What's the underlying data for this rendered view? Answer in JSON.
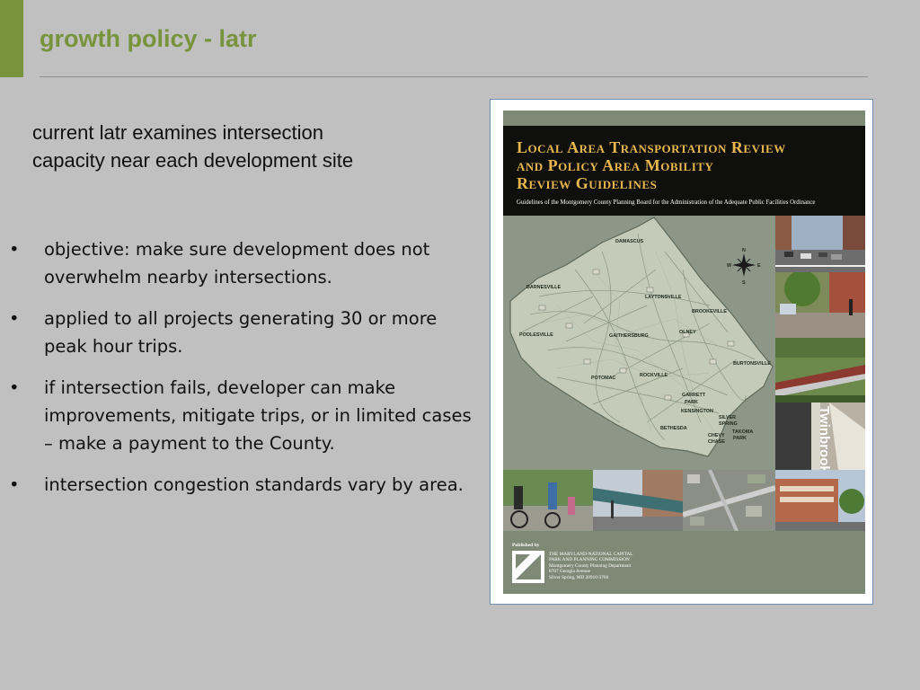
{
  "slide": {
    "title": "growth policy - latr",
    "intro": "current latr examines intersection capacity near each development site",
    "bullet_symbol": "•",
    "bullets": [
      "objective: make sure development does not overwhelm nearby intersections.",
      "applied to all projects generating 30 or more peak hour trips.",
      "if intersection fails, developer can make improvements, mitigate trips, or in limited cases – make a payment to the County.",
      "intersection congestion standards vary by area."
    ],
    "colors": {
      "accent": "#77933c",
      "background": "#c0c0c0",
      "text": "#111111"
    }
  },
  "cover": {
    "title_lines": [
      "Local Area Transportation Review",
      "and Policy Area Mobility",
      "Review Guidelines"
    ],
    "subtitle": "Guidelines of the Montgomery County Planning Board for the Administration of the Adequate Public Facilities Ordinance",
    "map_labels": {
      "damascus": "DAMASCUS",
      "barnesville": "BARNESVILLE",
      "laytonsville": "LAYTONSVILLE",
      "brookeville": "BROOKEVILLE",
      "olney": "OLNEY",
      "poolesville": "POOLESVILLE",
      "gaithersburg": "GAITHERSBURG",
      "potomac": "POTOMAC",
      "rockville": "ROCKVILLE",
      "burtonsville": "BURTONSVILLE",
      "garrett": "GARRETT",
      "park": "PARK",
      "kensington": "KENSINGTON",
      "bethesda": "BETHESDA",
      "silver": "SILVER",
      "spring": "SPRING",
      "takoma": "TAKOMA",
      "takoma_park": "PARK",
      "chevy": "CHEVY",
      "chase": "CHASE"
    },
    "compass": {
      "n": "N",
      "s": "S",
      "e": "E",
      "w": "W"
    },
    "photo_sign": "Twinbrook",
    "publisher_label": "Published by",
    "publisher_lines": [
      "THE MARYLAND-NATIONAL CAPITAL",
      "PARK AND PLANNING COMMISSION",
      "Montgomery County Planning Department",
      "8787 Georgia Avenue",
      "Silver Spring, MD 20910-3760"
    ],
    "colors": {
      "title_gold": "#e8b84f",
      "header_black": "#0f0f0c",
      "cover_gray": "#7f8a76"
    }
  }
}
